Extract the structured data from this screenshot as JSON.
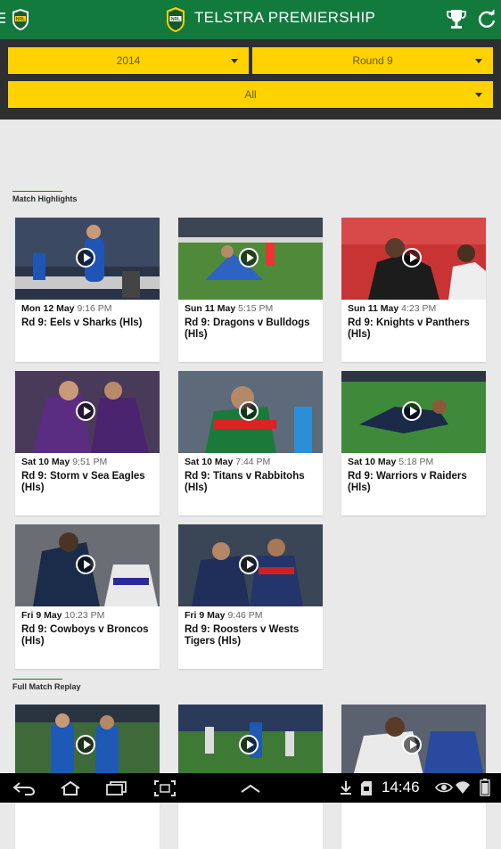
{
  "header": {
    "title": "TELSTRA PREMIERSHIP",
    "icons": [
      "menu-icon",
      "nrl-logo",
      "telstra-premiership-logo",
      "trophy-icon",
      "refresh-icon"
    ]
  },
  "filters": {
    "season": "2014",
    "round": "Round 9",
    "team": "All"
  },
  "sections": [
    {
      "title": "Match Highlights",
      "cards": [
        {
          "day": "Mon 12 May",
          "time": "9:16 PM",
          "title": "Rd 9: Eels v Sharks (Hls)"
        },
        {
          "day": "Sun 11 May",
          "time": "5:15 PM",
          "title": "Rd 9: Dragons v Bulldogs (Hls)"
        },
        {
          "day": "Sun 11 May",
          "time": "4:23 PM",
          "title": "Rd 9: Knights v Panthers (Hls)"
        },
        {
          "day": "Sat 10 May",
          "time": "9:51 PM",
          "title": "Rd 9: Storm v Sea Eagles (Hls)"
        },
        {
          "day": "Sat 10 May",
          "time": "7:44 PM",
          "title": "Rd 9: Titans v Rabbitohs (Hls)"
        },
        {
          "day": "Sat 10 May",
          "time": "5:18 PM",
          "title": "Rd 9: Warriors v Raiders (Hls)"
        },
        {
          "day": "Fri 9 May",
          "time": "10:23 PM",
          "title": "Rd 9: Cowboys v Broncos (Hls)"
        },
        {
          "day": "Fri 9 May",
          "time": "9:46 PM",
          "title": "Rd 9: Roosters v Wests Tigers (Hls)"
        }
      ]
    },
    {
      "title": "Full Match Replay",
      "cards": [
        {
          "day": "",
          "time": "",
          "title": ""
        },
        {
          "day": "",
          "time": "",
          "title": ""
        },
        {
          "day": "",
          "time": "",
          "title": ""
        }
      ]
    }
  ],
  "system_bar": {
    "time": "14:46",
    "icons": [
      "back-icon",
      "home-icon",
      "recent-apps-icon",
      "screenshot-icon",
      "up-chevron-icon",
      "download-icon",
      "sd-card-icon",
      "eye-icon",
      "wifi-icon",
      "battery-icon"
    ]
  },
  "colors": {
    "header_green": "#137a3d",
    "filter_yellow": "#ffd200",
    "filter_bar": "#2f2f2f",
    "background": "#e9e9e9"
  }
}
